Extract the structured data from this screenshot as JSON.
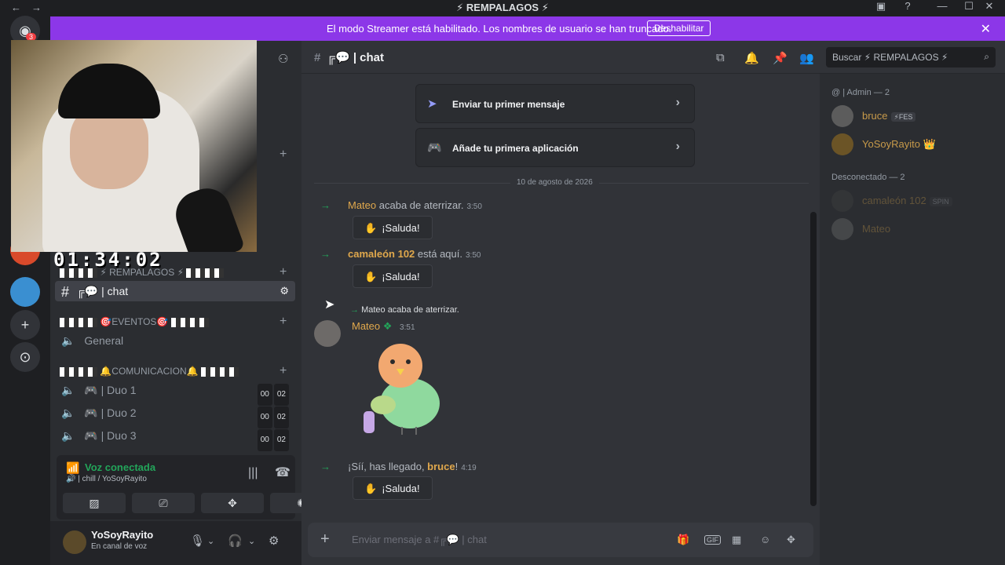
{
  "window": {
    "title": "⚡ REMPALAGOS ⚡",
    "back_label": "←",
    "forward_label": "→",
    "minimize": "—",
    "maximize": "☐",
    "close": "✕"
  },
  "banner": {
    "message": "El modo Streamer está habilitado. Los nombres de usuario se han truncado.",
    "disable_label": "Deshabilitar",
    "close": "✕"
  },
  "guilds": {
    "home_icon": "discord-icon",
    "home_badge": "3",
    "add_label": "+",
    "explore_label": "⊙"
  },
  "overlay": {
    "timer": "01:34:02"
  },
  "sidebar": {
    "server_category": "⚡ REMPALAGOS ⚡",
    "active_channel": "╔💬 | chat",
    "events_category": "🎯EVENTOS🎯",
    "general_channel": "General",
    "comms_category": "🔔COMUNICACION🔔",
    "duo_channels": [
      {
        "label": "🎮 | Duo 1",
        "count_a": "00",
        "count_b": "02"
      },
      {
        "label": "🎮 | Duo 2",
        "count_a": "00",
        "count_b": "02"
      },
      {
        "label": "🎮 | Duo 3",
        "count_a": "00",
        "count_b": "02"
      }
    ],
    "add": "+"
  },
  "voice": {
    "state": "Voz conectada",
    "channel": "🔊 | chill / YoSoyRayito"
  },
  "user": {
    "name": "YoSoyRayito",
    "status": "En canal de voz"
  },
  "header": {
    "channel": "╔💬 | chat",
    "search_placeholder": "Buscar ⚡ REMPALAGOS ⚡"
  },
  "onboarding": [
    {
      "label": "Enviar tu primer mensaje",
      "icon": "send-icon"
    },
    {
      "label": "Añade tu primera aplicación",
      "icon": "gamepad-icon"
    }
  ],
  "chat": {
    "date_divider": "10 de agosto de 2026",
    "join1": {
      "user": "Mateo",
      "text": " acaba de aterrizar.",
      "time": "3:50"
    },
    "join2": {
      "user": "camaleón 102",
      "text": " está aquí.",
      "time": "3:50"
    },
    "reply_preview": "Mateo acaba de aterrizar.",
    "message": {
      "user": "Mateo",
      "time": "3:51"
    },
    "join3": {
      "prefix": "¡Síí, has llegado, ",
      "user": "bruce",
      "suffix": "!",
      "time": "4:19"
    },
    "wave_label": "¡Saluda!"
  },
  "composer": {
    "placeholder": "Enviar mensaje a #╔💬 | chat",
    "gif_label": "GIF"
  },
  "members": {
    "admin_group": "@ | Admin — 2",
    "offline_group": "Desconectado — 2",
    "admins": [
      {
        "name": "bruce",
        "tag": "⚡FES",
        "color": "#c79a4a"
      },
      {
        "name": "YoSoyRayito",
        "tag": "👑",
        "color": "#c79a4a"
      }
    ],
    "offline": [
      {
        "name": "camaleón 102",
        "tag": "SPIN",
        "color": "#c79a4a"
      },
      {
        "name": "Mateo",
        "tag": "",
        "color": "#c79a4a"
      }
    ]
  }
}
